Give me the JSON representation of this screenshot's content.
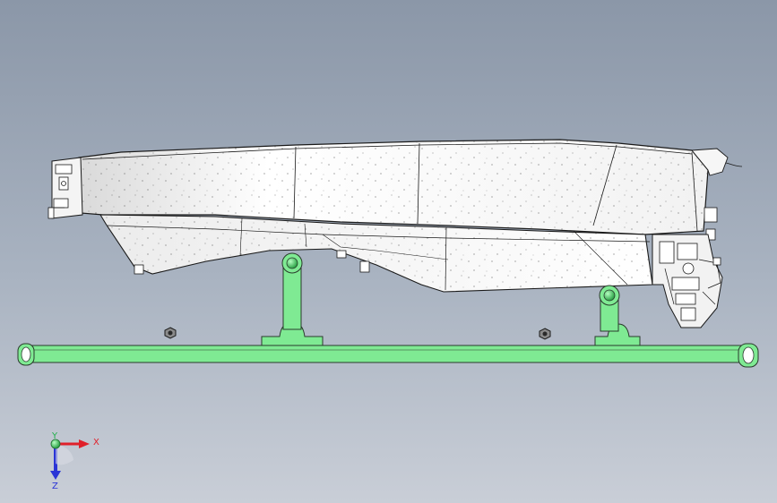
{
  "axes": {
    "x_label": "X",
    "y_label": "Y",
    "z_label": "Z",
    "x_color": "#e0202a",
    "y_color": "#22b14c",
    "z_color": "#2a34d6"
  },
  "colors": {
    "fixture": "#7fea93",
    "fixture_stroke": "#2a3a2c",
    "part_fill": "#ffffff",
    "part_shade": "#e4e4e4",
    "part_stroke": "#1a1a1a",
    "background_top": "#8b97a8",
    "background_bottom": "#c9ced7"
  },
  "icons": [
    "triad-icon",
    "origin-ball-icon",
    "hex-nut-icon",
    "roller-icon"
  ]
}
